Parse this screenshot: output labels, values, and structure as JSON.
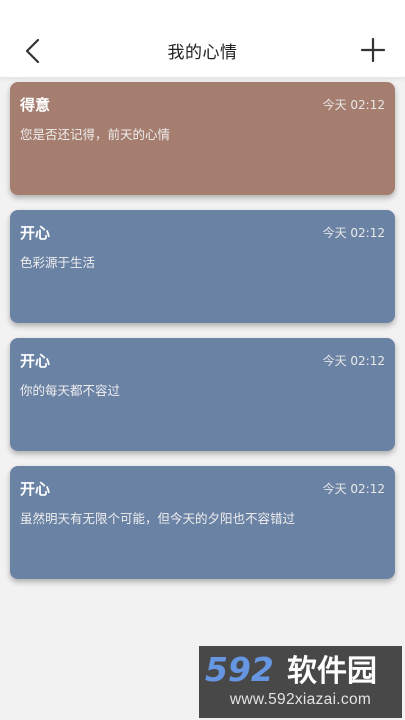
{
  "header": {
    "title": "我的心情",
    "back_icon": "chevron-left-icon",
    "add_icon": "plus-icon"
  },
  "entries": [
    {
      "mood": "得意",
      "time": "今天 02:12",
      "content": "您是否还记得，前天的心情",
      "color": "#a57e70"
    },
    {
      "mood": "开心",
      "time": "今天 02:12",
      "content": "色彩源于生活",
      "color": "#6a82a4"
    },
    {
      "mood": "开心",
      "time": "今天 02:12",
      "content": "你的每天都不容过",
      "color": "#6a82a4"
    },
    {
      "mood": "开心",
      "time": "今天 02:12",
      "content": "虽然明天有无限个可能，但今天的夕阳也不容错过",
      "color": "#6a82a4"
    }
  ],
  "watermark": {
    "brand": "592软件园",
    "url": "www.592xiazai.com"
  }
}
